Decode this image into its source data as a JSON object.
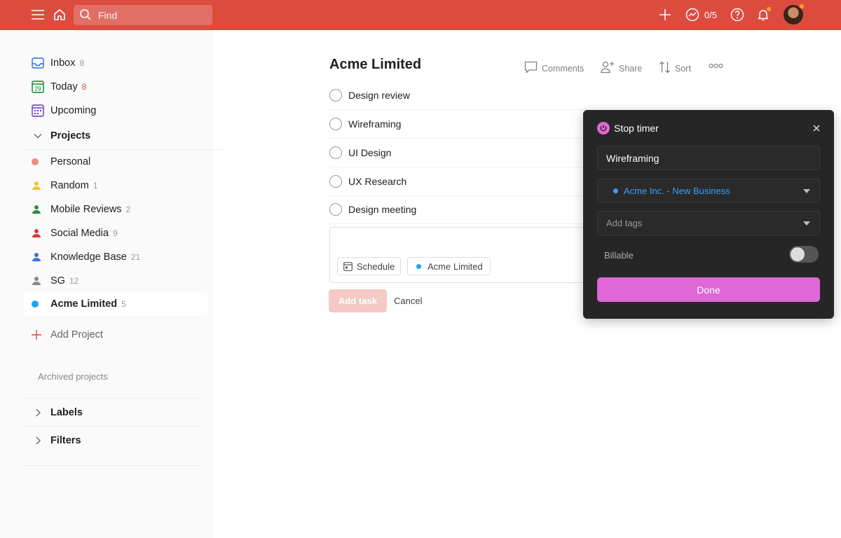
{
  "topbar": {
    "search_placeholder": "Find",
    "karma_text": "0/5"
  },
  "sidebar": {
    "items": [
      {
        "label": "Inbox",
        "count": "8"
      },
      {
        "label": "Today",
        "count": "8",
        "calendar_day": "29"
      },
      {
        "label": "Upcoming",
        "count": ""
      }
    ],
    "projects_header": "Projects",
    "projects": [
      {
        "label": "Personal",
        "count": "",
        "color": "#f28b82"
      },
      {
        "label": "Random",
        "count": "1",
        "color": "#f4c430"
      },
      {
        "label": "Mobile Reviews",
        "count": "2",
        "color": "#2e8b3d"
      },
      {
        "label": "Social Media",
        "count": "9",
        "color": "#d63a2f"
      },
      {
        "label": "Knowledge Base",
        "count": "21",
        "color": "#3f6fe0"
      },
      {
        "label": "SG",
        "count": "12",
        "color": "#888888"
      },
      {
        "label": "Acme Limited",
        "count": "5",
        "color": "#14aaf5"
      }
    ],
    "add_project": "Add Project",
    "archived": "Archived projects",
    "labels_header": "Labels",
    "filters_header": "Filters"
  },
  "main": {
    "title": "Acme Limited",
    "toolbar": {
      "comments": "Comments",
      "share": "Share",
      "sort": "Sort"
    },
    "tasks": [
      "Design review",
      "Wireframing",
      "UI Design",
      "UX Research",
      "Design meeting"
    ],
    "editor": {
      "schedule": "Schedule",
      "project": "Acme Limited"
    },
    "add_task": "Add task",
    "cancel": "Cancel"
  },
  "timer": {
    "title": "Stop timer",
    "description": "Wireframing",
    "project": "Acme Inc. - New Business",
    "tags_placeholder": "Add tags",
    "billable": "Billable",
    "billable_on": false,
    "done": "Done"
  },
  "colors": {
    "brand": "#db4c3f",
    "timer_accent": "#e067d6",
    "link_blue": "#3b9ef5"
  }
}
